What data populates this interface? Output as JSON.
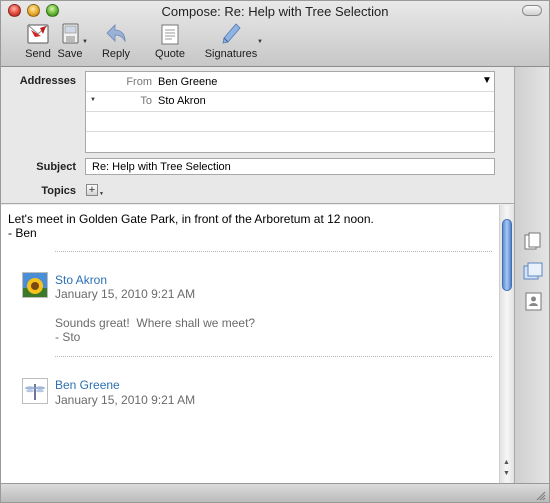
{
  "window": {
    "title": "Compose: Re: Help with Tree Selection"
  },
  "toolbar": {
    "send": "Send",
    "save": "Save",
    "reply": "Reply",
    "quote": "Quote",
    "signatures": "Signatures"
  },
  "header": {
    "addresses_label": "Addresses",
    "from_label": "From",
    "from_value": "Ben Greene",
    "to_label": "To",
    "to_value": "Sto Akron",
    "subject_label": "Subject",
    "subject_value": "Re: Help with Tree Selection",
    "topics_label": "Topics"
  },
  "message": {
    "line1": "Let's meet in Golden Gate Park, in front of the Arboretum at 12 noon.",
    "line2": "- Ben"
  },
  "thread": [
    {
      "name": "Sto Akron",
      "date": "January 15, 2010 9:21 AM",
      "line1": "Sounds great!  Where shall we meet?",
      "line2": "- Sto"
    },
    {
      "name": "Ben Greene",
      "date": "January 15, 2010 9:21 AM"
    }
  ],
  "colors": {
    "link": "#2d6fb3",
    "scroll_thumb": "#5e8fd6"
  }
}
